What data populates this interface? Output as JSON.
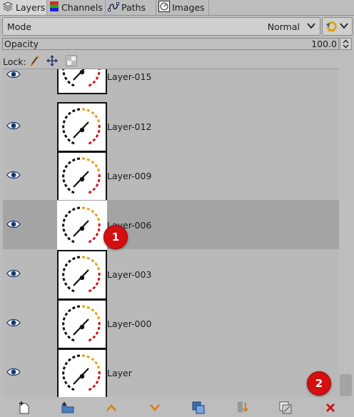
{
  "tabs": [
    {
      "label": "Layers",
      "icon": "layers-icon"
    },
    {
      "label": "Channels",
      "icon": "channels-icon"
    },
    {
      "label": "Paths",
      "icon": "paths-icon"
    },
    {
      "label": "Images",
      "icon": "images-icon"
    }
  ],
  "mode": {
    "label": "Mode",
    "value": "Normal"
  },
  "opacity": {
    "label": "Opacity",
    "value": "100.0",
    "fraction": 1.0
  },
  "lock": {
    "label": "Lock:"
  },
  "layers": [
    {
      "name": "Layer-015",
      "visible": true,
      "selected": false
    },
    {
      "name": "Layer-012",
      "visible": true,
      "selected": false
    },
    {
      "name": "Layer-009",
      "visible": true,
      "selected": false
    },
    {
      "name": "Layer-006",
      "visible": true,
      "selected": true
    },
    {
      "name": "Layer-003",
      "visible": true,
      "selected": false
    },
    {
      "name": "Layer-000",
      "visible": true,
      "selected": false
    },
    {
      "name": "Layer",
      "visible": true,
      "selected": false
    }
  ],
  "badges": [
    "1",
    "2"
  ],
  "colors": {
    "badge": "#d40f0f",
    "selected_row": "#a4a4a4",
    "accent_orange": "#e07a00",
    "delete_red": "#cc1111"
  }
}
